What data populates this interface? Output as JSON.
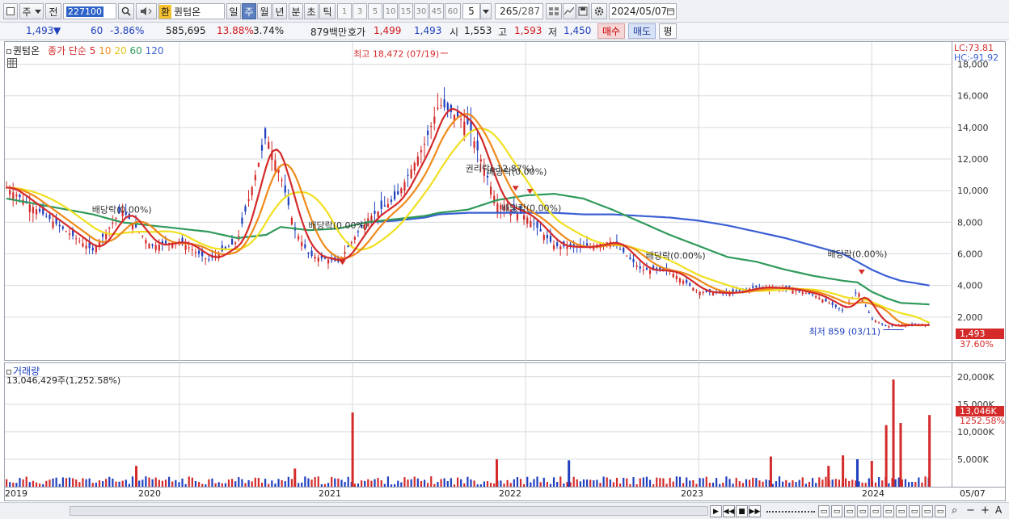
{
  "toolbar": {
    "type_label": "주",
    "prev_label": "전",
    "code": "227100",
    "currency_tag": "환",
    "stock_name": "퀀텀온",
    "periods": [
      "일",
      "주",
      "월",
      "년",
      "분",
      "초",
      "틱"
    ],
    "selected_period": "주",
    "intervals": [
      "1",
      "3",
      "5",
      "10",
      "15",
      "30",
      "45",
      "60"
    ],
    "interval_value": "5",
    "count": "265",
    "count_total": "/287",
    "date": "2024/05/07"
  },
  "info": {
    "price": "1,493",
    "change": "60",
    "change_pct": "-3.86%",
    "volume": "585,695",
    "turnover_pct": "13.88%",
    "pct2": "3.74%",
    "amount": "879백만",
    "bid_label": "호가",
    "bid": "1,499",
    "ask": "1,493",
    "open_label": "시",
    "open": "1,553",
    "high_label": "고",
    "high": "1,593",
    "low_label": "저",
    "low": "1,450",
    "buy_btn": "매수",
    "sell_btn": "매도",
    "eval_btn": "평"
  },
  "price_panel": {
    "name": "퀀텀온",
    "ma_label": "종가 단순",
    "ma_periods": [
      "5",
      "10",
      "20",
      "60",
      "120"
    ],
    "ma_colors": [
      "#d42a2a",
      "#ef8a1a",
      "#f0e020",
      "#2f9a5a",
      "#3a5fd4"
    ],
    "lc_label": "LC:73.81",
    "hc_label": "HC:-91.92",
    "current_price_tag": "1,493",
    "current_pct_tag": "37.60%",
    "annotations": {
      "high": "최고 18,472 (07/19)",
      "low": "최저 859 (03/11)",
      "div1": "배당락(0.00%)",
      "div2": "배당락(0.00%)",
      "rights": "권리락(-12.87%)",
      "div3": "배당락(0.00%)",
      "div4": "배당락(0.00%)",
      "div5": "배당락(0.00%)",
      "div6": "배당락(0.00%)"
    }
  },
  "volume_panel": {
    "title": "거래량",
    "summary": "13,046,429주(1,252.58%)",
    "current_tag": "13,046K",
    "current_pct": "1252.58%"
  },
  "x_axis": {
    "labels": [
      "2019",
      "2020",
      "2021",
      "2022",
      "2023",
      "2024"
    ],
    "right_label": "05/07"
  },
  "chart_data": [
    {
      "type": "line",
      "title": "퀀텀온",
      "x": [
        "2019-01",
        "2019-04",
        "2019-07",
        "2019-09",
        "2019-11",
        "2020-01",
        "2020-03",
        "2020-05",
        "2020-07",
        "2020-08",
        "2020-09",
        "2020-10",
        "2020-12",
        "2021-02",
        "2021-04",
        "2021-06",
        "2021-07",
        "2021-09",
        "2021-11",
        "2022-01",
        "2022-03",
        "2022-05",
        "2022-07",
        "2022-09",
        "2022-11",
        "2023-01",
        "2023-03",
        "2023-05",
        "2023-07",
        "2023-09",
        "2023-11",
        "2023-12",
        "2024-01",
        "2024-02",
        "2024-03",
        "2024-05"
      ],
      "series": [
        {
          "name": "종가",
          "values": [
            10200,
            8200,
            6200,
            8800,
            6500,
            6800,
            5600,
            6800,
            13500,
            11000,
            7500,
            5900,
            5500,
            8200,
            9500,
            13000,
            15500,
            14200,
            9200,
            8400,
            6500,
            6400,
            6800,
            5000,
            4900,
            3600,
            3500,
            3900,
            3800,
            3400,
            2400,
            3700,
            1900,
            1400,
            1500,
            1493
          ]
        }
      ],
      "ma_lines": {
        "ma60": [
          9500,
          9000,
          8500,
          8000,
          7800,
          7600,
          7400,
          7000,
          7200,
          7700,
          7600,
          7500,
          7600,
          8000,
          8200,
          8400,
          8600,
          8800,
          9400,
          9700,
          9800,
          9500,
          8800,
          8000,
          7200,
          6500,
          5800,
          5500,
          5000,
          4600,
          4300,
          4200,
          3600,
          3200,
          2900,
          2800
        ],
        "ma120": [
          null,
          null,
          null,
          null,
          null,
          null,
          null,
          null,
          null,
          null,
          null,
          null,
          null,
          8000,
          8100,
          8300,
          8500,
          8600,
          8600,
          8600,
          8600,
          8500,
          8500,
          8400,
          8300,
          8100,
          7800,
          7400,
          7000,
          6500,
          6000,
          5500,
          5000,
          4600,
          4300,
          4000
        ]
      },
      "ylim": [
        0,
        19000
      ],
      "yticks": [
        2000,
        4000,
        6000,
        8000,
        10000,
        12000,
        14000,
        16000,
        18000
      ],
      "ytick_labels": [
        "2,000",
        "4,000",
        "6,000",
        "8,000",
        "10,000",
        "12,000",
        "14,000",
        "16,000",
        "18,000"
      ],
      "max_point": {
        "date": "07/19",
        "value": 18472
      },
      "min_point": {
        "date": "03/11",
        "value": 859
      },
      "grid": true
    },
    {
      "type": "bar",
      "title": "거래량",
      "x": [
        "2019-10",
        "2020-09",
        "2021-01",
        "2021-11",
        "2022-04",
        "2023-06",
        "2023-10",
        "2023-11",
        "2023-12",
        "2024-01",
        "2024-02",
        "2024-02b",
        "2024-03",
        "2024-05"
      ],
      "values": [
        3800,
        3300,
        13500,
        5000,
        4800,
        5500,
        3800,
        5700,
        5000,
        4700,
        11200,
        19500,
        11600,
        13046
      ],
      "unit": "K",
      "ylim": [
        0,
        21000
      ],
      "yticks": [
        5000,
        10000,
        15000,
        20000
      ],
      "ytick_labels": [
        "5,000K",
        "10,000K",
        "15,000K",
        "20,000K"
      ]
    }
  ]
}
